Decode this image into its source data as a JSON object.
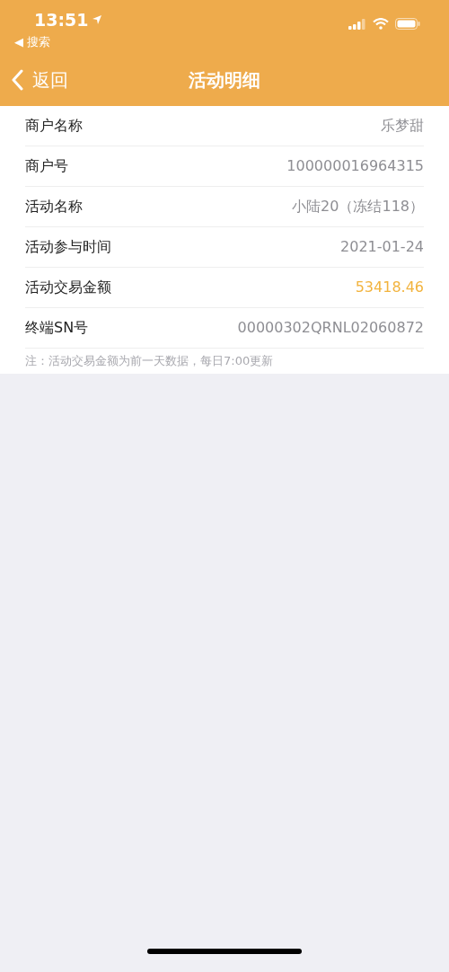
{
  "status_bar": {
    "time": "13:51",
    "back_app": "◀ 搜索"
  },
  "nav": {
    "back": "返回",
    "title": "活动明细"
  },
  "rows": [
    {
      "label": "商户名称",
      "value": "乐梦甜",
      "kind": "plain"
    },
    {
      "label": "商户号",
      "value": "100000016964315",
      "kind": "plain"
    },
    {
      "label": "活动名称",
      "value": "小陆20（冻结118）",
      "kind": "plain"
    },
    {
      "label": "活动参与时间",
      "value": "2021-01-24",
      "kind": "plain"
    },
    {
      "label": "活动交易金额",
      "value": "53418.46",
      "kind": "amount"
    },
    {
      "label": "终端SN号",
      "value": "00000302QRNL02060872",
      "kind": "plain"
    }
  ],
  "note": "注：活动交易金额为前一天数据，每日7:00更新"
}
